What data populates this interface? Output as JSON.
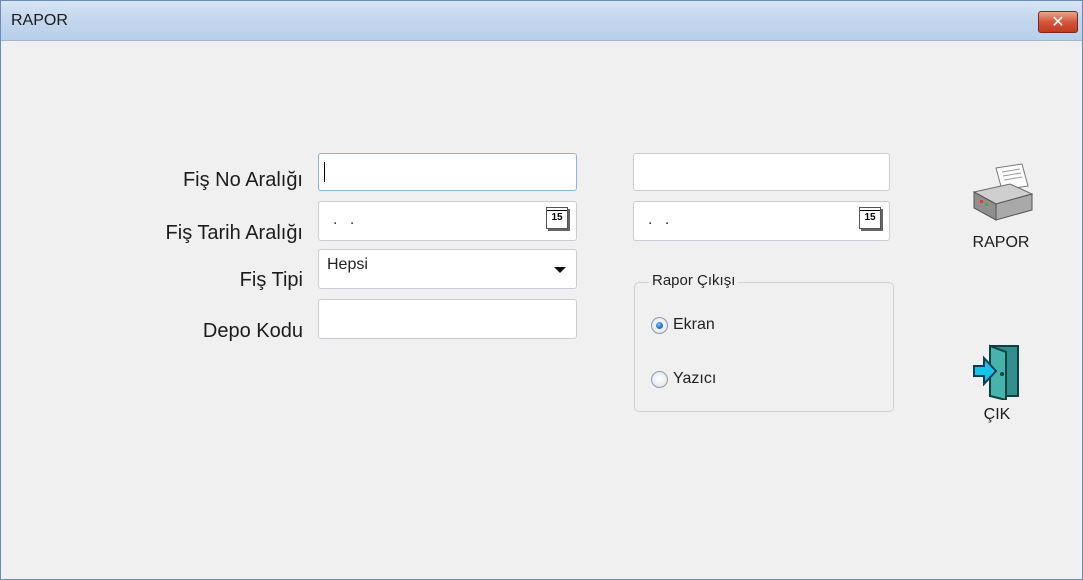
{
  "window": {
    "title": "RAPOR",
    "close_glyph": "✕"
  },
  "form": {
    "fis_no": {
      "label": "Fiş No Aralığı",
      "from_value": "",
      "to_value": ""
    },
    "fis_tarih": {
      "label": "Fiş Tarih Aralığı",
      "from_value": ". .",
      "to_value": ". .",
      "calendar_icon_text": "15"
    },
    "fis_tipi": {
      "label": "Fiş Tipi",
      "selected": "Hepsi"
    },
    "depo_kodu": {
      "label": "Depo Kodu",
      "value": ""
    }
  },
  "output_group": {
    "title": "Rapor Çıkışı",
    "options": [
      {
        "label": "Ekran",
        "checked": true
      },
      {
        "label": "Yazıcı",
        "checked": false
      }
    ]
  },
  "actions": {
    "report": {
      "label": "RAPOR",
      "icon": "printer-icon"
    },
    "exit": {
      "label": "ÇIK",
      "icon": "exit-door-icon"
    }
  },
  "colors": {
    "radio_checked": "#1f6fd1",
    "close_button": "#c23a1e",
    "titlebar": "#c4d7ee"
  }
}
